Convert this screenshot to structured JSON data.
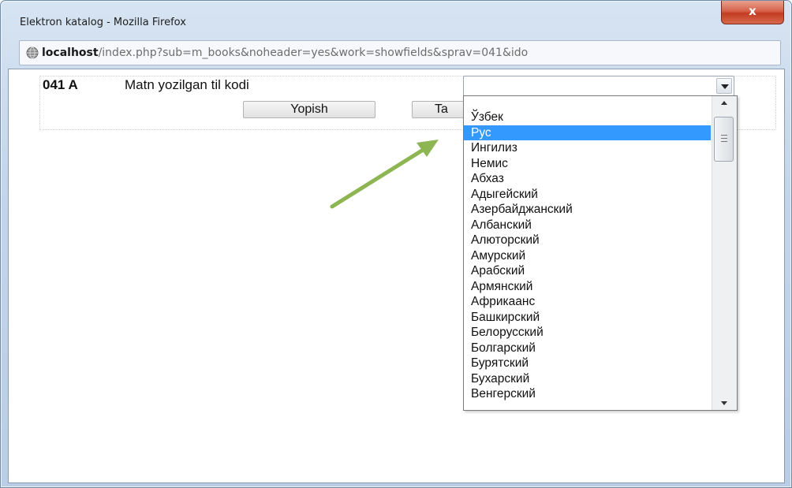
{
  "window": {
    "title": "Elektron katalog - Mozilla Firefox",
    "close_label": "x"
  },
  "address": {
    "host": "localhost",
    "path": "/index.php?sub=m_books&noheader=yes&work=showfields&sprav=041&ido"
  },
  "field": {
    "code": "041 A",
    "label": "Matn yozilgan til kodi",
    "select_value": ""
  },
  "buttons": {
    "close": "Yopish",
    "second": "Ta"
  },
  "dropdown": {
    "selected_index": 1,
    "options": [
      "Ўзбек",
      "Рус",
      "Ингилиз",
      "Немис",
      "Абхаз",
      "Адыгейский",
      "Азербайджанский",
      "Албанский",
      "Алюторский",
      "Амурский",
      "Арабский",
      "Армянский",
      "Африкаанс",
      "Башкирский",
      "Белорусский",
      "Болгарский",
      "Бурятский",
      "Бухарский",
      "Венгерский"
    ],
    "highlight_color": "#3399ff"
  },
  "annotation": {
    "arrow_color": "#8db552"
  }
}
